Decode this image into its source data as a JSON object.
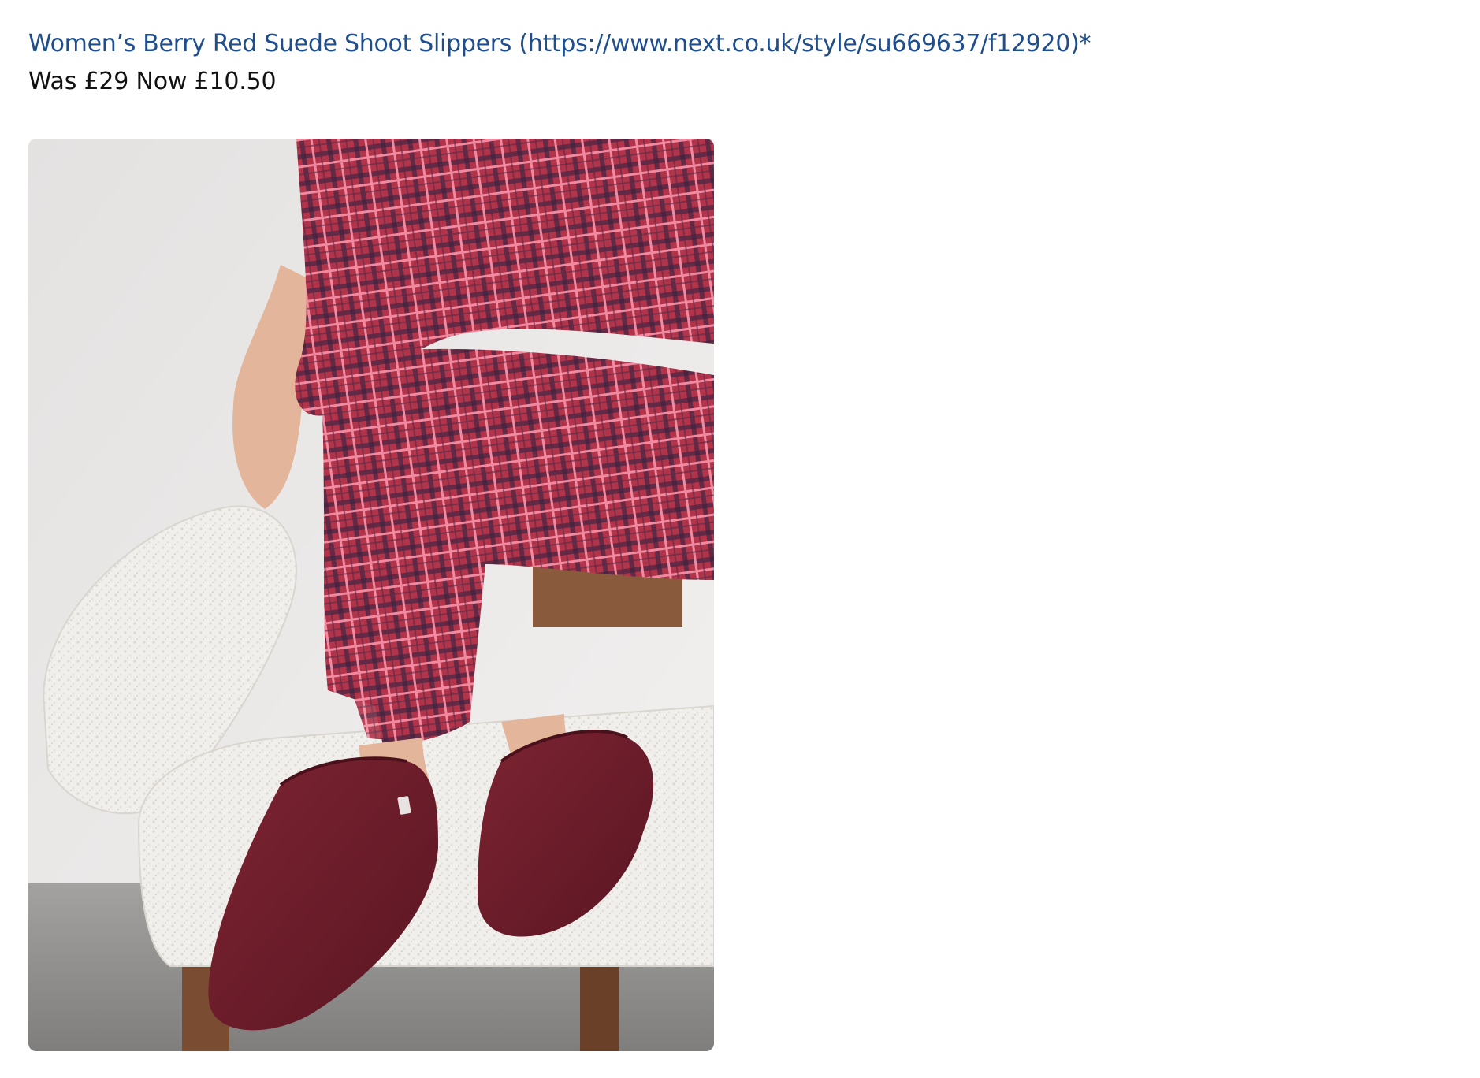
{
  "product": {
    "link_text": "Women’s Berry Red Suede Shoot Slippers (https://www.next.co.uk/style/su669637/f12920)",
    "asterisk": "*",
    "price_text": "Was £29 Now £10.50"
  },
  "image": {
    "subject": "product-photo-berry-red-suede-slippers",
    "colors": {
      "wall": "#ebe9e8",
      "floor": "#8d8c8a",
      "chair_fabric": "#f1efec",
      "chair_wood": "#8a5a3c",
      "pyjama_base": "#b2344a",
      "pyjama_check_dark": "#3a2340",
      "pyjama_check_light": "#f08aa0",
      "slipper": "#6e1c2a",
      "skin": "#e3b59a"
    }
  }
}
